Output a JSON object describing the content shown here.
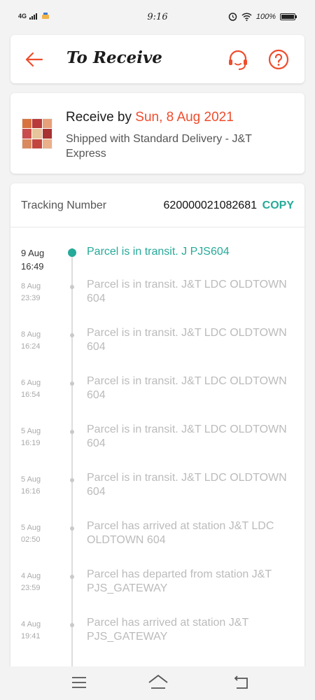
{
  "status_bar": {
    "network": "4G",
    "time": "9:16",
    "battery": "100%"
  },
  "header": {
    "title": "To Receive"
  },
  "delivery": {
    "receive_prefix": "Receive by ",
    "receive_date": "Sun, 8 Aug 2021",
    "shipping_text": "Shipped with Standard Delivery  - J&T Express"
  },
  "tracking": {
    "label": "Tracking Number",
    "number": "620000021082681",
    "copy_label": "COPY",
    "events": [
      {
        "date": "9 Aug",
        "time": "16:49",
        "text": "Parcel is in transit. J PJS604"
      },
      {
        "date": "8 Aug",
        "time": "23:39",
        "text": "Parcel is in transit. J&T LDC OLDTOWN 604"
      },
      {
        "date": "8 Aug",
        "time": "16:24",
        "text": "Parcel is in transit. J&T LDC OLDTOWN 604"
      },
      {
        "date": "6 Aug",
        "time": "16:54",
        "text": "Parcel is in transit. J&T LDC OLDTOWN 604"
      },
      {
        "date": "5 Aug",
        "time": "16:19",
        "text": "Parcel is in transit. J&T LDC OLDTOWN 604"
      },
      {
        "date": "5 Aug",
        "time": "16:16",
        "text": "Parcel is in transit. J&T LDC OLDTOWN 604"
      },
      {
        "date": "5 Aug",
        "time": "02:50",
        "text": "Parcel has arrived at station J&T LDC OLDTOWN 604"
      },
      {
        "date": "4 Aug",
        "time": "23:59",
        "text": "Parcel has departed from station J&T PJS_GATEWAY"
      },
      {
        "date": "4 Aug",
        "time": "19:41",
        "text": "Parcel has arrived at station J&T PJS_GATEWAY"
      }
    ]
  },
  "colors": {
    "accent": "#ee4d2d",
    "teal": "#26aa99",
    "muted": "#bbbbbb"
  },
  "icons": {
    "back": "arrow-left-icon",
    "support": "headset-icon",
    "help": "question-circle-icon",
    "nav_menu": "menu-icon",
    "nav_home": "home-icon",
    "nav_back": "back-icon"
  }
}
